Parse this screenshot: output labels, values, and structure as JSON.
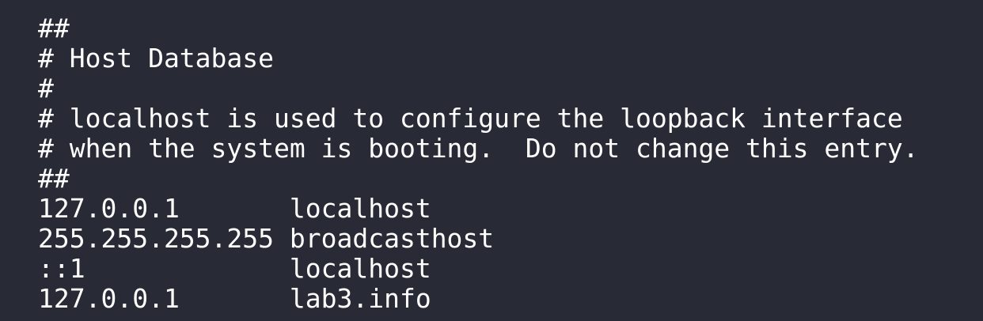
{
  "terminal": {
    "background_color": "#282a35",
    "text_color": "#ffffff",
    "lines": [
      "##",
      "# Host Database",
      "#",
      "# localhost is used to configure the loopback interface",
      "# when the system is booting.  Do not change this entry.",
      "##",
      "127.0.0.1       localhost",
      "255.255.255.255 broadcasthost",
      "::1             localhost",
      "127.0.0.1       lab3.info"
    ]
  }
}
